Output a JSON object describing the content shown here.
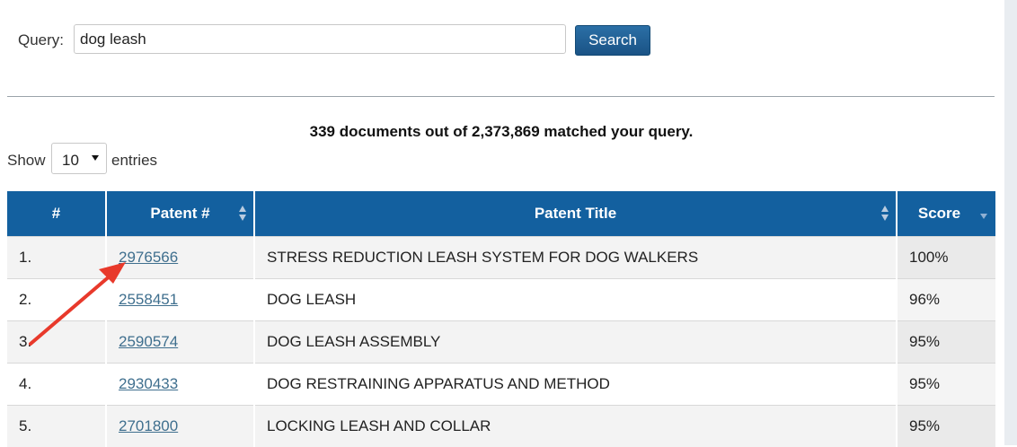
{
  "search": {
    "label": "Query:",
    "value": "dog leash",
    "button_label": "Search"
  },
  "summary": {
    "text": "339 documents out of 2,373,869 matched your query."
  },
  "length_menu": {
    "show_label": "Show",
    "selected": "10",
    "entries_label": "entries"
  },
  "table": {
    "headers": {
      "rank": "#",
      "patent": "Patent #",
      "title": "Patent Title",
      "score": "Score"
    },
    "rows": [
      {
        "rank": "1.",
        "patent": "2976566",
        "title": "STRESS REDUCTION LEASH SYSTEM FOR DOG WALKERS",
        "score": "100%"
      },
      {
        "rank": "2.",
        "patent": "2558451",
        "title": "DOG LEASH",
        "score": "96%"
      },
      {
        "rank": "3.",
        "patent": "2590574",
        "title": "DOG LEASH ASSEMBLY",
        "score": "95%"
      },
      {
        "rank": "4.",
        "patent": "2930433",
        "title": "DOG RESTRAINING APPARATUS AND METHOD",
        "score": "95%"
      },
      {
        "rank": "5.",
        "patent": "2701800",
        "title": "LOCKING LEASH AND COLLAR",
        "score": "95%"
      }
    ]
  },
  "colors": {
    "header_bg": "#13609f",
    "button_bg": "#1a5386",
    "link": "#3f6f8e",
    "annotation_arrow": "#e8392b"
  },
  "icons": {
    "sort_both": "sort-both-icon",
    "sort_desc": "sort-desc-icon",
    "dropdown": "caret-down-icon",
    "annotation": "red-arrow-annotation"
  }
}
